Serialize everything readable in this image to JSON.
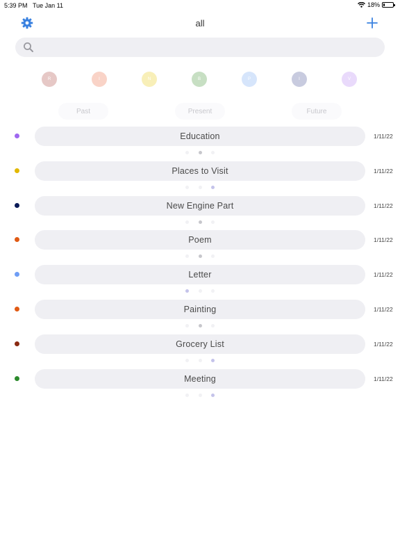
{
  "status_bar": {
    "time": "5:39 PM",
    "date": "Tue Jan 11",
    "battery": "18%",
    "battery_level": 0.18
  },
  "header": {
    "title": "all",
    "settings_icon": "gear-icon",
    "add_icon": "plus-icon"
  },
  "search": {
    "placeholder": "",
    "value": ""
  },
  "filters": [
    {
      "letter": "R",
      "color": "#e6c8c6"
    },
    {
      "letter": "I",
      "color": "#f9d3c7"
    },
    {
      "letter": "N",
      "color": "#f8efb8"
    },
    {
      "letter": "B",
      "color": "#c7dfc3"
    },
    {
      "letter": "P",
      "color": "#d6e5fb"
    },
    {
      "letter": "I",
      "color": "#c8cbdf"
    },
    {
      "letter": "V",
      "color": "#e9dafb"
    }
  ],
  "segments": [
    "Past",
    "Present",
    "Future"
  ],
  "items": [
    {
      "title": "Education",
      "date": "1/11/22",
      "color": "#9f68f0",
      "page": 1
    },
    {
      "title": "Places to Visit",
      "date": "1/11/22",
      "color": "#e2b800",
      "page": 2
    },
    {
      "title": "New Engine Part",
      "date": "1/11/22",
      "color": "#0a1a57",
      "page": 1
    },
    {
      "title": "Poem",
      "date": "1/11/22",
      "color": "#e05a14",
      "page": 1
    },
    {
      "title": "Letter",
      "date": "1/11/22",
      "color": "#6e9df5",
      "page": 0
    },
    {
      "title": "Painting",
      "date": "1/11/22",
      "color": "#e05a14",
      "page": 1
    },
    {
      "title": "Grocery List",
      "date": "1/11/22",
      "color": "#8a2a12",
      "page": 2
    },
    {
      "title": "Meeting",
      "date": "1/11/22",
      "color": "#2c8a2c",
      "page": 2
    }
  ]
}
